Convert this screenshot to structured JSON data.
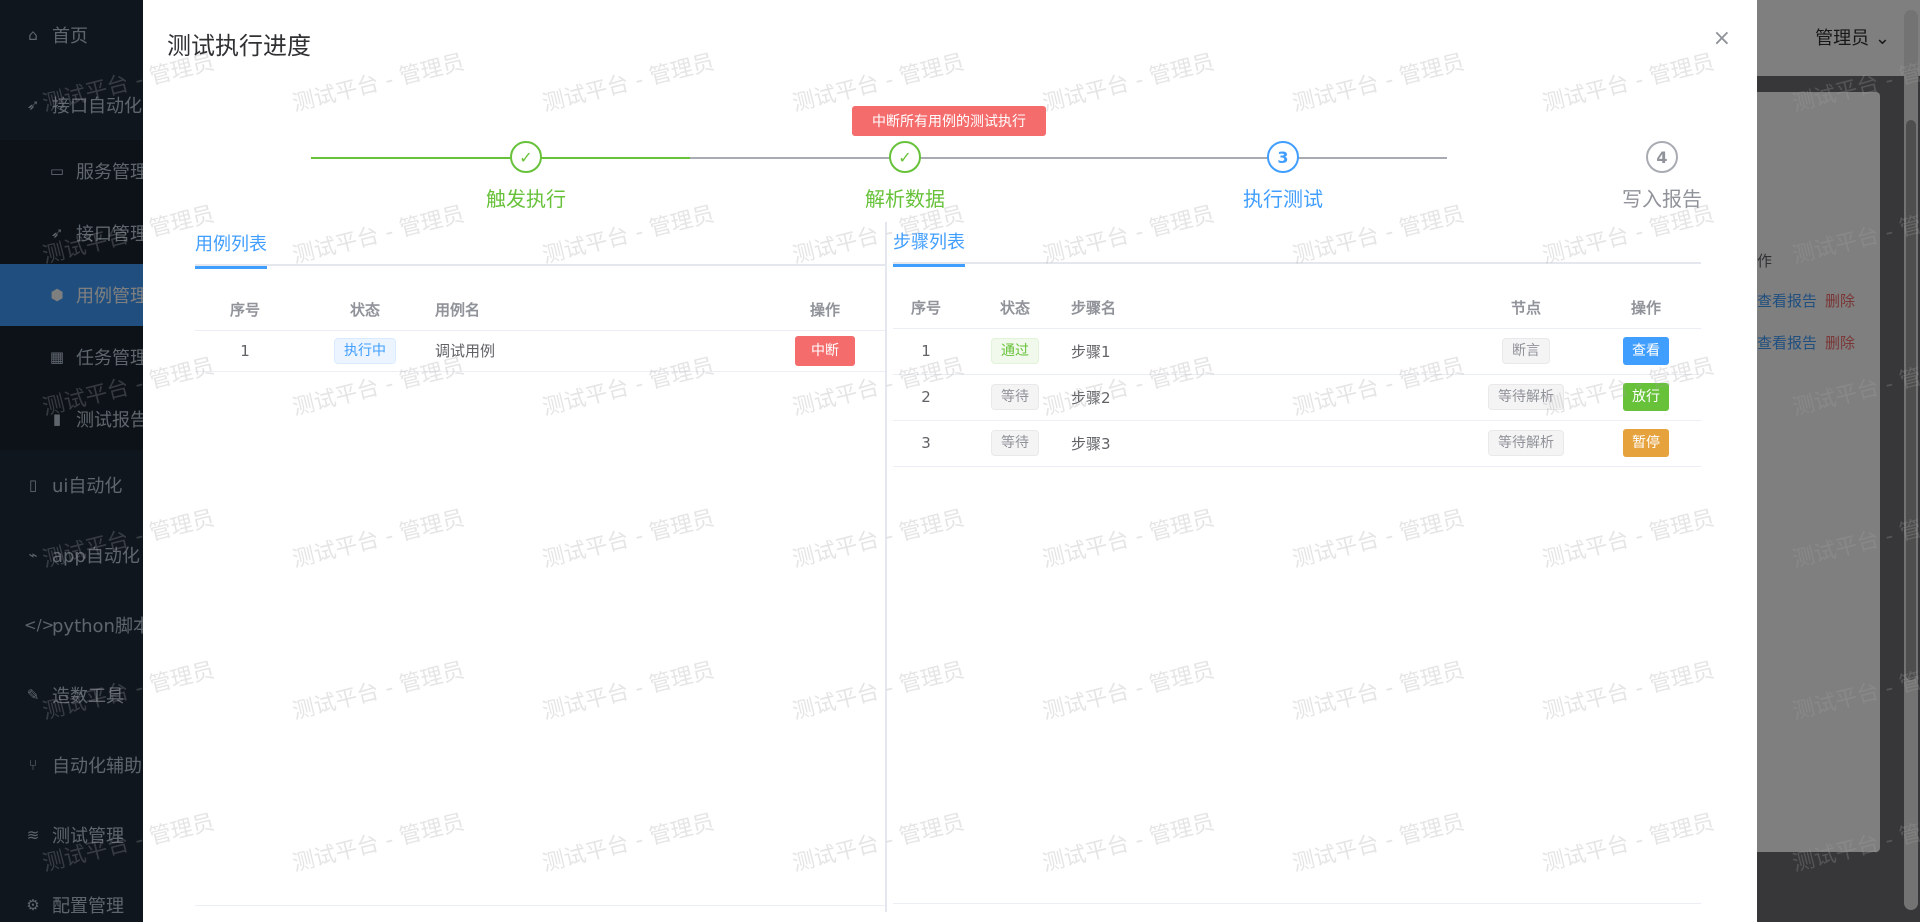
{
  "sidebar": {
    "items": [
      {
        "label": "首页",
        "icon": "home-icon"
      },
      {
        "label": "接口自动化",
        "icon": "rocket-icon"
      },
      {
        "label": "服务管理",
        "icon": "folder-icon",
        "sub": true
      },
      {
        "label": "接口管理",
        "icon": "rocket-icon",
        "sub": true
      },
      {
        "label": "用例管理",
        "icon": "cube-icon",
        "sub": true,
        "active": true
      },
      {
        "label": "任务管理",
        "icon": "calendar-icon",
        "sub": true
      },
      {
        "label": "测试报告",
        "icon": "chart-icon",
        "sub": true
      },
      {
        "label": "ui自动化",
        "icon": "book-icon"
      },
      {
        "label": "app自动化",
        "icon": "mobile-icon"
      },
      {
        "label": "python脚本",
        "icon": "code-icon"
      },
      {
        "label": "造数工具",
        "icon": "tool-icon"
      },
      {
        "label": "自动化辅助",
        "icon": "branch-icon"
      },
      {
        "label": "测试管理",
        "icon": "layers-icon"
      },
      {
        "label": "配置管理",
        "icon": "gear-icon"
      }
    ]
  },
  "header": {
    "user": "管理员"
  },
  "background": {
    "partial_text": "作",
    "row_links": [
      {
        "view": "查看报告",
        "delete": "删除"
      },
      {
        "view": "查看报告",
        "delete": "删除"
      }
    ]
  },
  "dialog": {
    "title": "测试执行进度",
    "close": "×",
    "abort_all_label": "中断所有用例的测试执行",
    "steps": [
      {
        "title": "触发执行",
        "status": "done",
        "num": "✓"
      },
      {
        "title": "解析数据",
        "status": "done",
        "num": "✓"
      },
      {
        "title": "执行测试",
        "status": "current",
        "num": "3"
      },
      {
        "title": "写入报告",
        "status": "wait",
        "num": "4"
      }
    ],
    "case_panel": {
      "tab": "用例列表",
      "columns": {
        "index": "序号",
        "status": "状态",
        "name": "用例名",
        "action": "操作"
      },
      "rows": [
        {
          "index": "1",
          "status": "执行中",
          "name": "调试用例",
          "action": "中断"
        }
      ]
    },
    "step_panel": {
      "tab": "步骤列表",
      "columns": {
        "index": "序号",
        "status": "状态",
        "name": "步骤名",
        "node": "节点",
        "action": "操作"
      },
      "rows": [
        {
          "index": "1",
          "status": "通过",
          "status_type": "pass",
          "name": "步骤1",
          "node": "断言",
          "action": "查看",
          "action_type": "primary"
        },
        {
          "index": "2",
          "status": "等待",
          "status_type": "wait",
          "name": "步骤2",
          "node": "等待解析",
          "action": "放行",
          "action_type": "success"
        },
        {
          "index": "3",
          "status": "等待",
          "status_type": "wait",
          "name": "步骤3",
          "node": "等待解析",
          "action": "暂停",
          "action_type": "warning"
        }
      ]
    }
  },
  "watermark": {
    "text": "测试平台 - 管理员"
  },
  "colors": {
    "primary": "#409eff",
    "success": "#67c23a",
    "warning": "#e6a23c",
    "danger": "#f56c6c",
    "sidebar_bg": "#1f2d3d"
  }
}
